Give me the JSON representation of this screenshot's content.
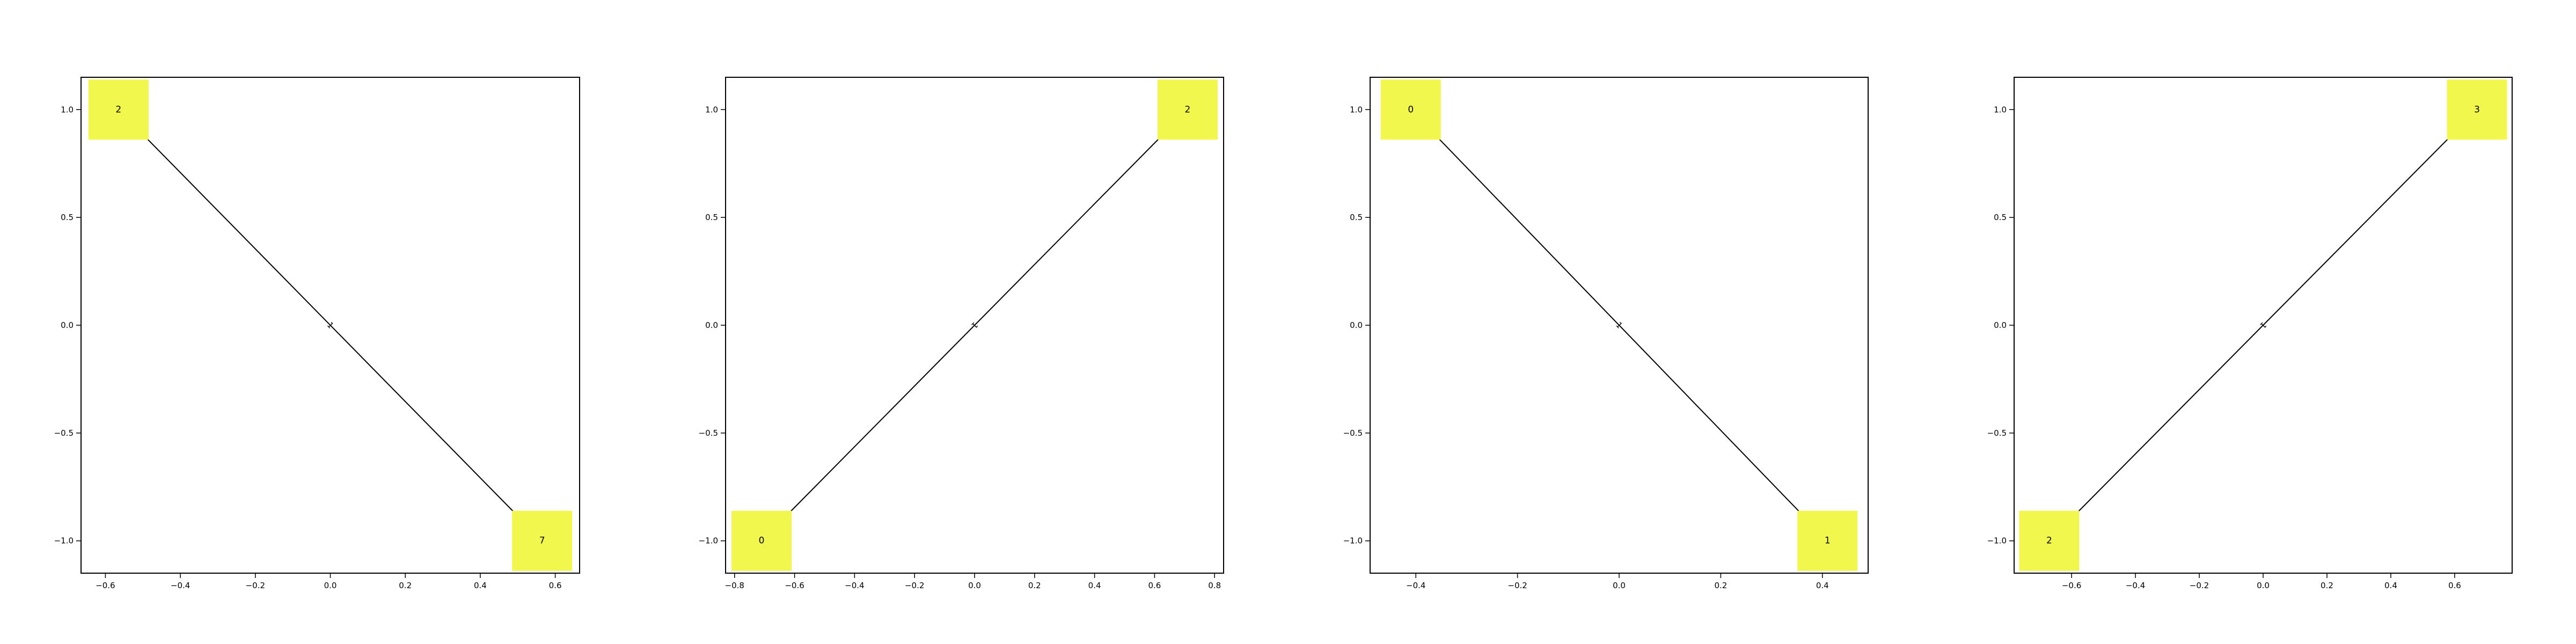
{
  "node_color": "#f2f74e",
  "edge_color": "#000000",
  "axis_color": "#000000",
  "panels": [
    {
      "xlim": [
        -0.665,
        0.665
      ],
      "ylim": [
        -1.15,
        1.15
      ],
      "xticks": [
        -0.6,
        -0.4,
        -0.2,
        0.0,
        0.2,
        0.4,
        0.6
      ],
      "xtick_labels": [
        "−0.6",
        "−0.4",
        "−0.2",
        "0.0",
        "0.2",
        "0.4",
        "0.6"
      ],
      "yticks": [
        1.0,
        0.5,
        0.0,
        -0.5,
        -1.0
      ],
      "ytick_labels": [
        "1.0",
        "0.5",
        "0.0",
        "−0.5",
        "−1.0"
      ],
      "nodes": [
        {
          "label": "2",
          "x": -0.565,
          "y": 1.0
        },
        {
          "label": "7",
          "x": 0.565,
          "y": -1.0
        }
      ],
      "edges": [
        {
          "from": 0,
          "to": 1,
          "label": "1"
        }
      ]
    },
    {
      "xlim": [
        -0.83,
        0.83
      ],
      "ylim": [
        -1.15,
        1.15
      ],
      "xticks": [
        -0.8,
        -0.6,
        -0.4,
        -0.2,
        0.0,
        0.2,
        0.4,
        0.6,
        0.8
      ],
      "xtick_labels": [
        "−0.8",
        "−0.6",
        "−0.4",
        "−0.2",
        "0.0",
        "0.2",
        "0.4",
        "0.6",
        "0.8"
      ],
      "yticks": [
        1.0,
        0.5,
        0.0,
        -0.5,
        -1.0
      ],
      "ytick_labels": [
        "1.0",
        "0.5",
        "0.0",
        "−0.5",
        "−1.0"
      ],
      "nodes": [
        {
          "label": "2",
          "x": 0.71,
          "y": 1.0
        },
        {
          "label": "0",
          "x": -0.71,
          "y": -1.0
        }
      ],
      "edges": [
        {
          "from": 0,
          "to": 1,
          "label": "1"
        }
      ]
    },
    {
      "xlim": [
        -0.49,
        0.49
      ],
      "ylim": [
        -1.15,
        1.15
      ],
      "xticks": [
        -0.4,
        -0.2,
        0.0,
        0.2,
        0.4
      ],
      "xtick_labels": [
        "−0.4",
        "−0.2",
        "0.0",
        "0.2",
        "0.4"
      ],
      "yticks": [
        1.0,
        0.5,
        0.0,
        -0.5,
        -1.0
      ],
      "ytick_labels": [
        "1.0",
        "0.5",
        "0.0",
        "−0.5",
        "−1.0"
      ],
      "nodes": [
        {
          "label": "0",
          "x": -0.41,
          "y": 1.0
        },
        {
          "label": "1",
          "x": 0.41,
          "y": -1.0
        }
      ],
      "edges": [
        {
          "from": 0,
          "to": 1,
          "label": "1"
        }
      ]
    },
    {
      "xlim": [
        -0.78,
        0.78
      ],
      "ylim": [
        -1.15,
        1.15
      ],
      "xticks": [
        -0.6,
        -0.4,
        -0.2,
        0.0,
        0.2,
        0.4,
        0.6
      ],
      "xtick_labels": [
        "−0.6",
        "−0.4",
        "−0.2",
        "0.0",
        "0.2",
        "0.4",
        "0.6"
      ],
      "yticks": [
        1.0,
        0.5,
        0.0,
        -0.5,
        -1.0
      ],
      "ytick_labels": [
        "1.0",
        "0.5",
        "0.0",
        "−0.5",
        "−1.0"
      ],
      "nodes": [
        {
          "label": "3",
          "x": 0.67,
          "y": 1.0
        },
        {
          "label": "2",
          "x": -0.67,
          "y": -1.0
        }
      ],
      "edges": [
        {
          "from": 0,
          "to": 1,
          "label": "1"
        }
      ]
    }
  ]
}
